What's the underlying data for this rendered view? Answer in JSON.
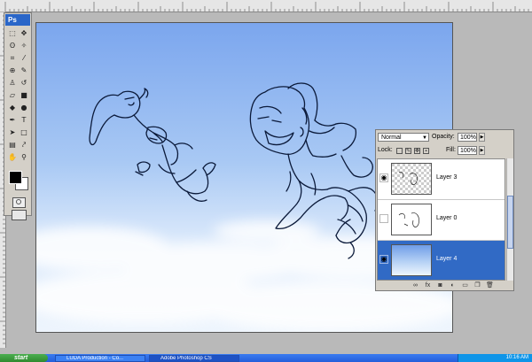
{
  "app": {
    "logo": "Ps"
  },
  "toolbox": {
    "tools": [
      {
        "name": "marquee-tool",
        "glyph": "⬚"
      },
      {
        "name": "move-tool",
        "glyph": "✥"
      },
      {
        "name": "lasso-tool",
        "glyph": "ʘ"
      },
      {
        "name": "magic-wand-tool",
        "glyph": "✧"
      },
      {
        "name": "crop-tool",
        "glyph": "⌗"
      },
      {
        "name": "slice-tool",
        "glyph": "⁄"
      },
      {
        "name": "healing-tool",
        "glyph": "⊕"
      },
      {
        "name": "brush-tool",
        "glyph": "✎"
      },
      {
        "name": "stamp-tool",
        "glyph": "♙"
      },
      {
        "name": "history-brush-tool",
        "glyph": "↺"
      },
      {
        "name": "eraser-tool",
        "glyph": "▱"
      },
      {
        "name": "gradient-tool",
        "glyph": "■"
      },
      {
        "name": "blur-tool",
        "glyph": "◆"
      },
      {
        "name": "dodge-tool",
        "glyph": "●"
      },
      {
        "name": "pen-tool",
        "glyph": "✒"
      },
      {
        "name": "type-tool",
        "glyph": "T"
      },
      {
        "name": "path-selection-tool",
        "glyph": "➤"
      },
      {
        "name": "shape-tool",
        "glyph": "□"
      },
      {
        "name": "notes-tool",
        "glyph": "▤"
      },
      {
        "name": "eyedropper-tool",
        "glyph": "⤤"
      },
      {
        "name": "hand-tool",
        "glyph": "✋"
      },
      {
        "name": "zoom-tool",
        "glyph": "⚲"
      }
    ]
  },
  "layers_panel": {
    "blend_mode": "Normal",
    "opacity_label": "Opacity:",
    "opacity_value": "100%",
    "lock_label": "Lock:",
    "fill_label": "Fill:",
    "fill_value": "100%",
    "layers": [
      {
        "name": "Layer 3",
        "visible": true,
        "selected": false,
        "thumb": "transparent-sketch"
      },
      {
        "name": "Layer 0",
        "visible": false,
        "selected": false,
        "thumb": "white-sketch"
      },
      {
        "name": "Layer 4",
        "visible": true,
        "selected": true,
        "thumb": "sky"
      }
    ],
    "bottom_buttons": [
      {
        "name": "link-layers-icon",
        "glyph": "∞"
      },
      {
        "name": "layer-style-icon",
        "glyph": "fx"
      },
      {
        "name": "layer-mask-icon",
        "glyph": "◙"
      },
      {
        "name": "adjustment-layer-icon",
        "glyph": "◐"
      },
      {
        "name": "new-group-icon",
        "glyph": "▭"
      },
      {
        "name": "new-layer-icon",
        "glyph": "❐"
      },
      {
        "name": "trash-icon",
        "glyph": "🗑"
      }
    ]
  },
  "taskbar": {
    "start_label": "start",
    "tasks": [
      {
        "label": "LUDA Production - Co..."
      },
      {
        "label": "Adobe Photoshop CS"
      }
    ],
    "clock": "10:16 AM"
  },
  "colors": {
    "sky_top": "#7fa9ee",
    "sky_bottom": "#dfeefb",
    "selection": "#316ac5",
    "taskbar": "#245edb"
  }
}
